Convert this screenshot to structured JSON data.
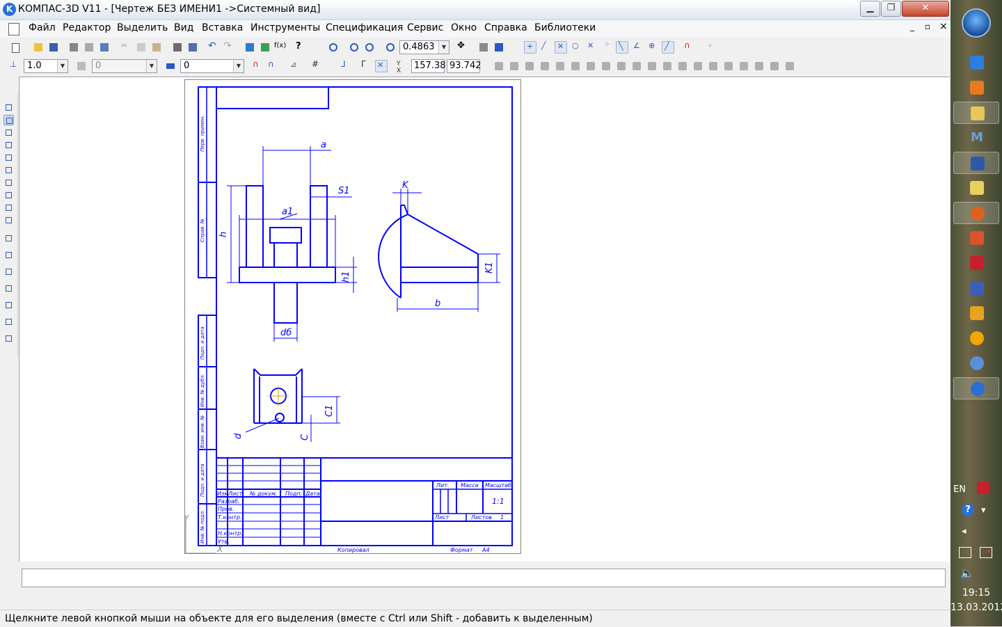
{
  "window": {
    "title": "КОМПАС-3D V11 - [Чертеж БЕЗ ИМЕНИ1 ->Системный вид]",
    "app_icon_letter": "K"
  },
  "menu": {
    "items": [
      "Файл",
      "Редактор",
      "Выделить",
      "Вид",
      "Вставка",
      "Инструменты",
      "Спецификация",
      "Сервис",
      "Окно",
      "Справка",
      "Библиотеки"
    ],
    "mdi_minimize": "_",
    "mdi_restore": "▫",
    "mdi_close": "×"
  },
  "toolbar1": {
    "zoom_value": "0.4863"
  },
  "toolbar2": {
    "line_scale": "1.0",
    "layer_state": "0",
    "layer_value": "0",
    "cursor_x": "157.38",
    "cursor_y": "93.742"
  },
  "drawing": {
    "dims": {
      "a": "a",
      "s1": "S1",
      "a1": "a1",
      "h": "h",
      "h1": "h1",
      "d_b": "dб",
      "k": "K",
      "k1": "K1",
      "b": "b",
      "c1": "C1",
      "c": "C",
      "d": "d"
    },
    "side_labels": [
      "Перв. примен.",
      "Справ. №",
      "Подп. и дата",
      "Инв. № дубл.",
      "Взам. инв. №",
      "Подп. и дата",
      "Инв. № подл."
    ],
    "title_block": {
      "headers": [
        "Изм",
        "Лист",
        "№ докум.",
        "Подп.",
        "Дата"
      ],
      "rows": [
        "Разраб.",
        "Пров.",
        "Т.контр.",
        "",
        "Н.контр.",
        "Утв."
      ],
      "lit": "Лит.",
      "mass": "Масса",
      "scale_label": "Масштаб",
      "scale_value": "1:1",
      "sheet": "Лист",
      "sheets": "Листов",
      "sheets_count": "1"
    },
    "copied_label": "Копировал",
    "format_label": "Формат",
    "format_value": "A4",
    "axis_y": "Y",
    "axis_x": "X"
  },
  "status": {
    "message": "Щелкните левой кнопкой мыши на объекте для его выделения (вместе с Ctrl или Shift - добавить к выделенным)"
  },
  "taskbar": {
    "lang": "EN",
    "time": "19:15",
    "date": "13.03.2012"
  },
  "colors": {
    "drawing_line": "#0000ff",
    "workspace": "#ffffff"
  }
}
